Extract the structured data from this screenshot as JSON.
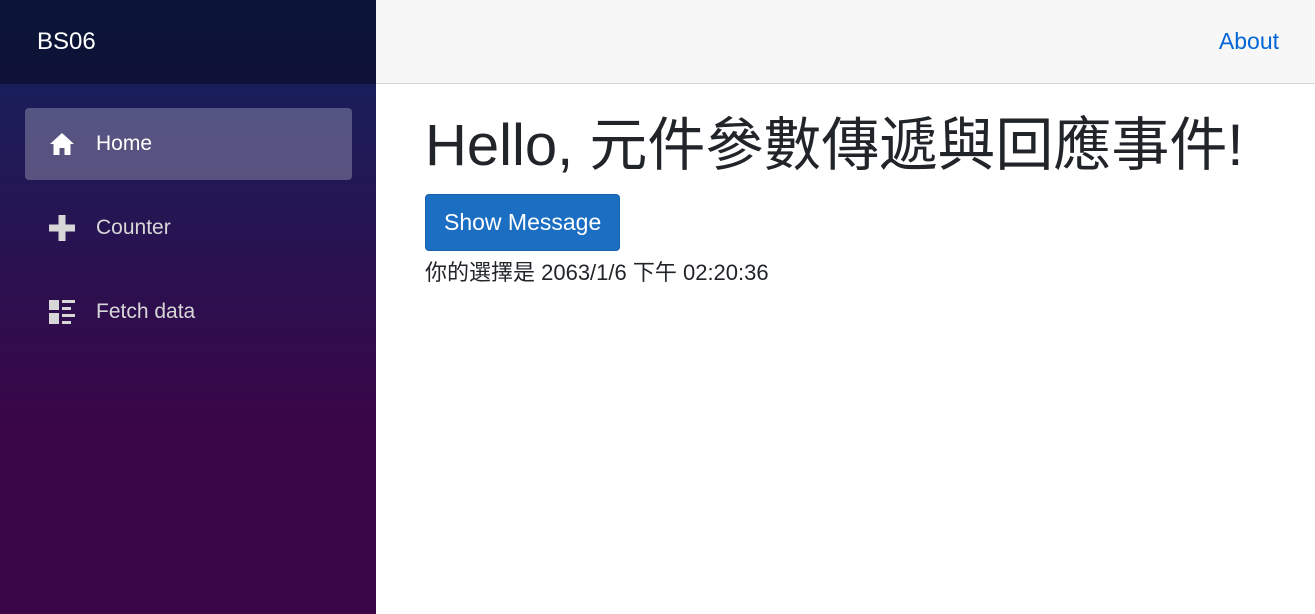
{
  "brand": "BS06",
  "nav": {
    "items": [
      {
        "label": "Home",
        "icon": "home-icon",
        "active": true
      },
      {
        "label": "Counter",
        "icon": "plus-icon",
        "active": false
      },
      {
        "label": "Fetch data",
        "icon": "list-rich-icon",
        "active": false
      }
    ]
  },
  "top_row": {
    "about_label": "About"
  },
  "main": {
    "heading": "Hello, 元件參數傳遞與回應事件!",
    "button_label": "Show Message",
    "result_text": "你的選擇是 2063/1/6 下午 02:20:36"
  },
  "colors": {
    "sidebar_top": "#11245f",
    "sidebar_bottom": "#3a0647",
    "button": "#1b6ec2",
    "link": "#0366d6"
  }
}
